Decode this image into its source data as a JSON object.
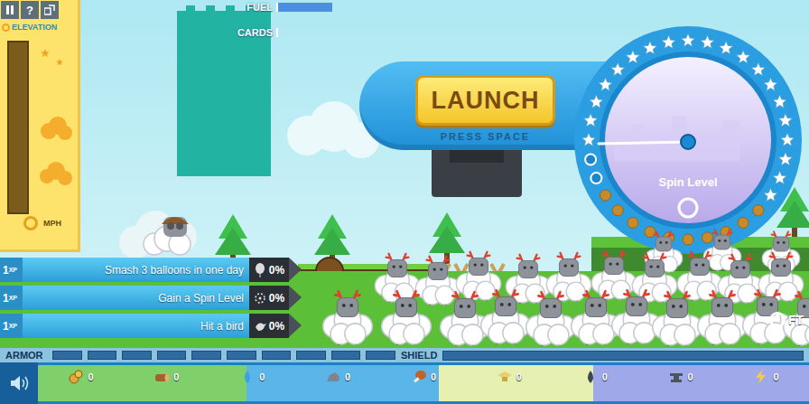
{
  "toolbar": {
    "help": "?"
  },
  "elevation": {
    "label": "ELEVATION",
    "level": 0
  },
  "speed": {
    "unit": "MPH"
  },
  "fuel": {
    "label": "FUEL",
    "level": 0.2
  },
  "cards": {
    "label": "CARDS",
    "level": 0
  },
  "launch": {
    "label": "LAUNCH",
    "hint": "PRESS SPACE"
  },
  "spin_dial": {
    "label": "Spin Level",
    "total": 32,
    "stars": 20,
    "spins": 2
  },
  "quests": [
    {
      "xp": "1",
      "xp_unit": "XP",
      "text": "Smash 3 balloons in one day",
      "progress": "0%",
      "level": 0,
      "kind": "balloon"
    },
    {
      "xp": "1",
      "xp_unit": "XP",
      "text": "Gain a Spin Level",
      "progress": "0%",
      "level": 0,
      "kind": "spin"
    },
    {
      "xp": "1",
      "xp_unit": "XP",
      "text": "Hit a bird",
      "progress": "0%",
      "level": 0,
      "kind": "bird"
    }
  ],
  "distance": {
    "unit": "FT"
  },
  "armor": {
    "label": "ARMOR",
    "segments": 10,
    "level": 0
  },
  "shield": {
    "label": "SHIELD",
    "level": 0
  },
  "sound": {
    "muted": false
  },
  "collectibles": [
    {
      "kind": "coins",
      "count": "0"
    },
    {
      "kind": "log",
      "count": "0"
    },
    {
      "kind": "drop",
      "count": "0"
    },
    {
      "kind": "rock",
      "count": "0"
    },
    {
      "kind": "meat",
      "count": "0"
    },
    {
      "kind": "cap",
      "count": "0"
    },
    {
      "kind": "oil",
      "count": "0"
    },
    {
      "kind": "anvil",
      "count": "0"
    },
    {
      "kind": "bolt",
      "count": "0"
    }
  ]
}
